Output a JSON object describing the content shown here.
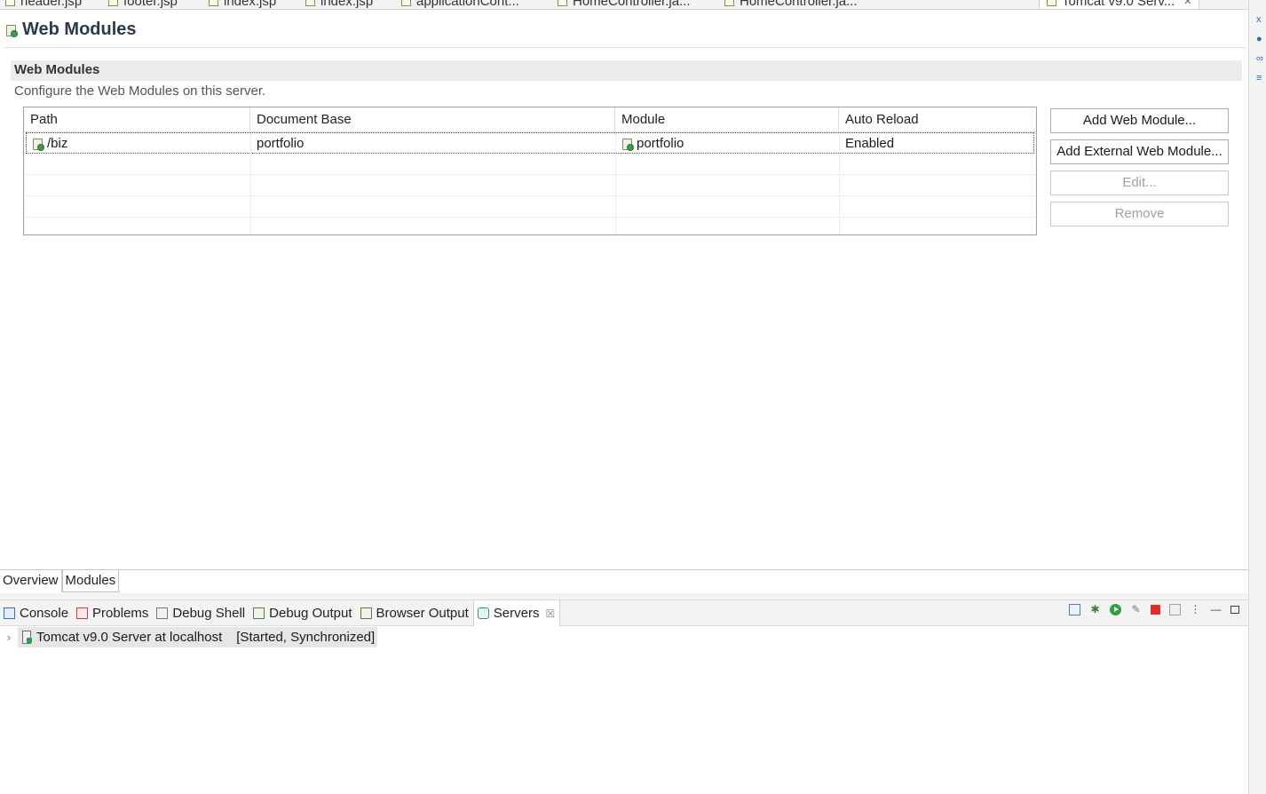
{
  "editor_tabs": [
    {
      "label": "header.jsp",
      "active": false
    },
    {
      "label": "footer.jsp",
      "active": false
    },
    {
      "label": "index.jsp",
      "active": false
    },
    {
      "label": "index.jsp",
      "active": false
    },
    {
      "label": "applicationCont...",
      "active": false
    },
    {
      "label": "HomeController.ja...",
      "active": false
    },
    {
      "label": "HomeController.ja...",
      "active": false
    },
    {
      "label": "Tomcat v9.0 Serv...",
      "active": true
    }
  ],
  "page": {
    "title": "Web Modules"
  },
  "section": {
    "title": "Web Modules",
    "description": "Configure the Web Modules on this server."
  },
  "table": {
    "columns": [
      "Path",
      "Document Base",
      "Module",
      "Auto Reload"
    ],
    "rows": [
      {
        "path": "/biz",
        "document_base": "portfolio",
        "module": "portfolio",
        "auto_reload": "Enabled"
      }
    ]
  },
  "buttons": {
    "add_web_module": "Add Web Module...",
    "add_external_web_module": "Add External Web Module...",
    "edit": "Edit...",
    "remove": "Remove"
  },
  "editor_bottom_tabs": [
    {
      "label": "Overview",
      "active": false
    },
    {
      "label": "Modules",
      "active": true
    }
  ],
  "views": {
    "tabs": [
      {
        "label": "Console",
        "icon": "console-icon"
      },
      {
        "label": "Problems",
        "icon": "problems-icon"
      },
      {
        "label": "Debug Shell",
        "icon": "debug-shell-icon"
      },
      {
        "label": "Debug Output",
        "icon": "debug-output-icon"
      },
      {
        "label": "Browser Output",
        "icon": "browser-output-icon"
      },
      {
        "label": "Servers",
        "icon": "servers-icon",
        "active": true
      }
    ],
    "close_glyph": "☒"
  },
  "servers": {
    "items": [
      {
        "name": "Tomcat v9.0 Server at localhost",
        "status": "[Started, Synchronized]"
      }
    ]
  },
  "colors": {
    "accent_start": "#2ea043",
    "stop": "#d9302c",
    "title": "#2b3a4a"
  }
}
